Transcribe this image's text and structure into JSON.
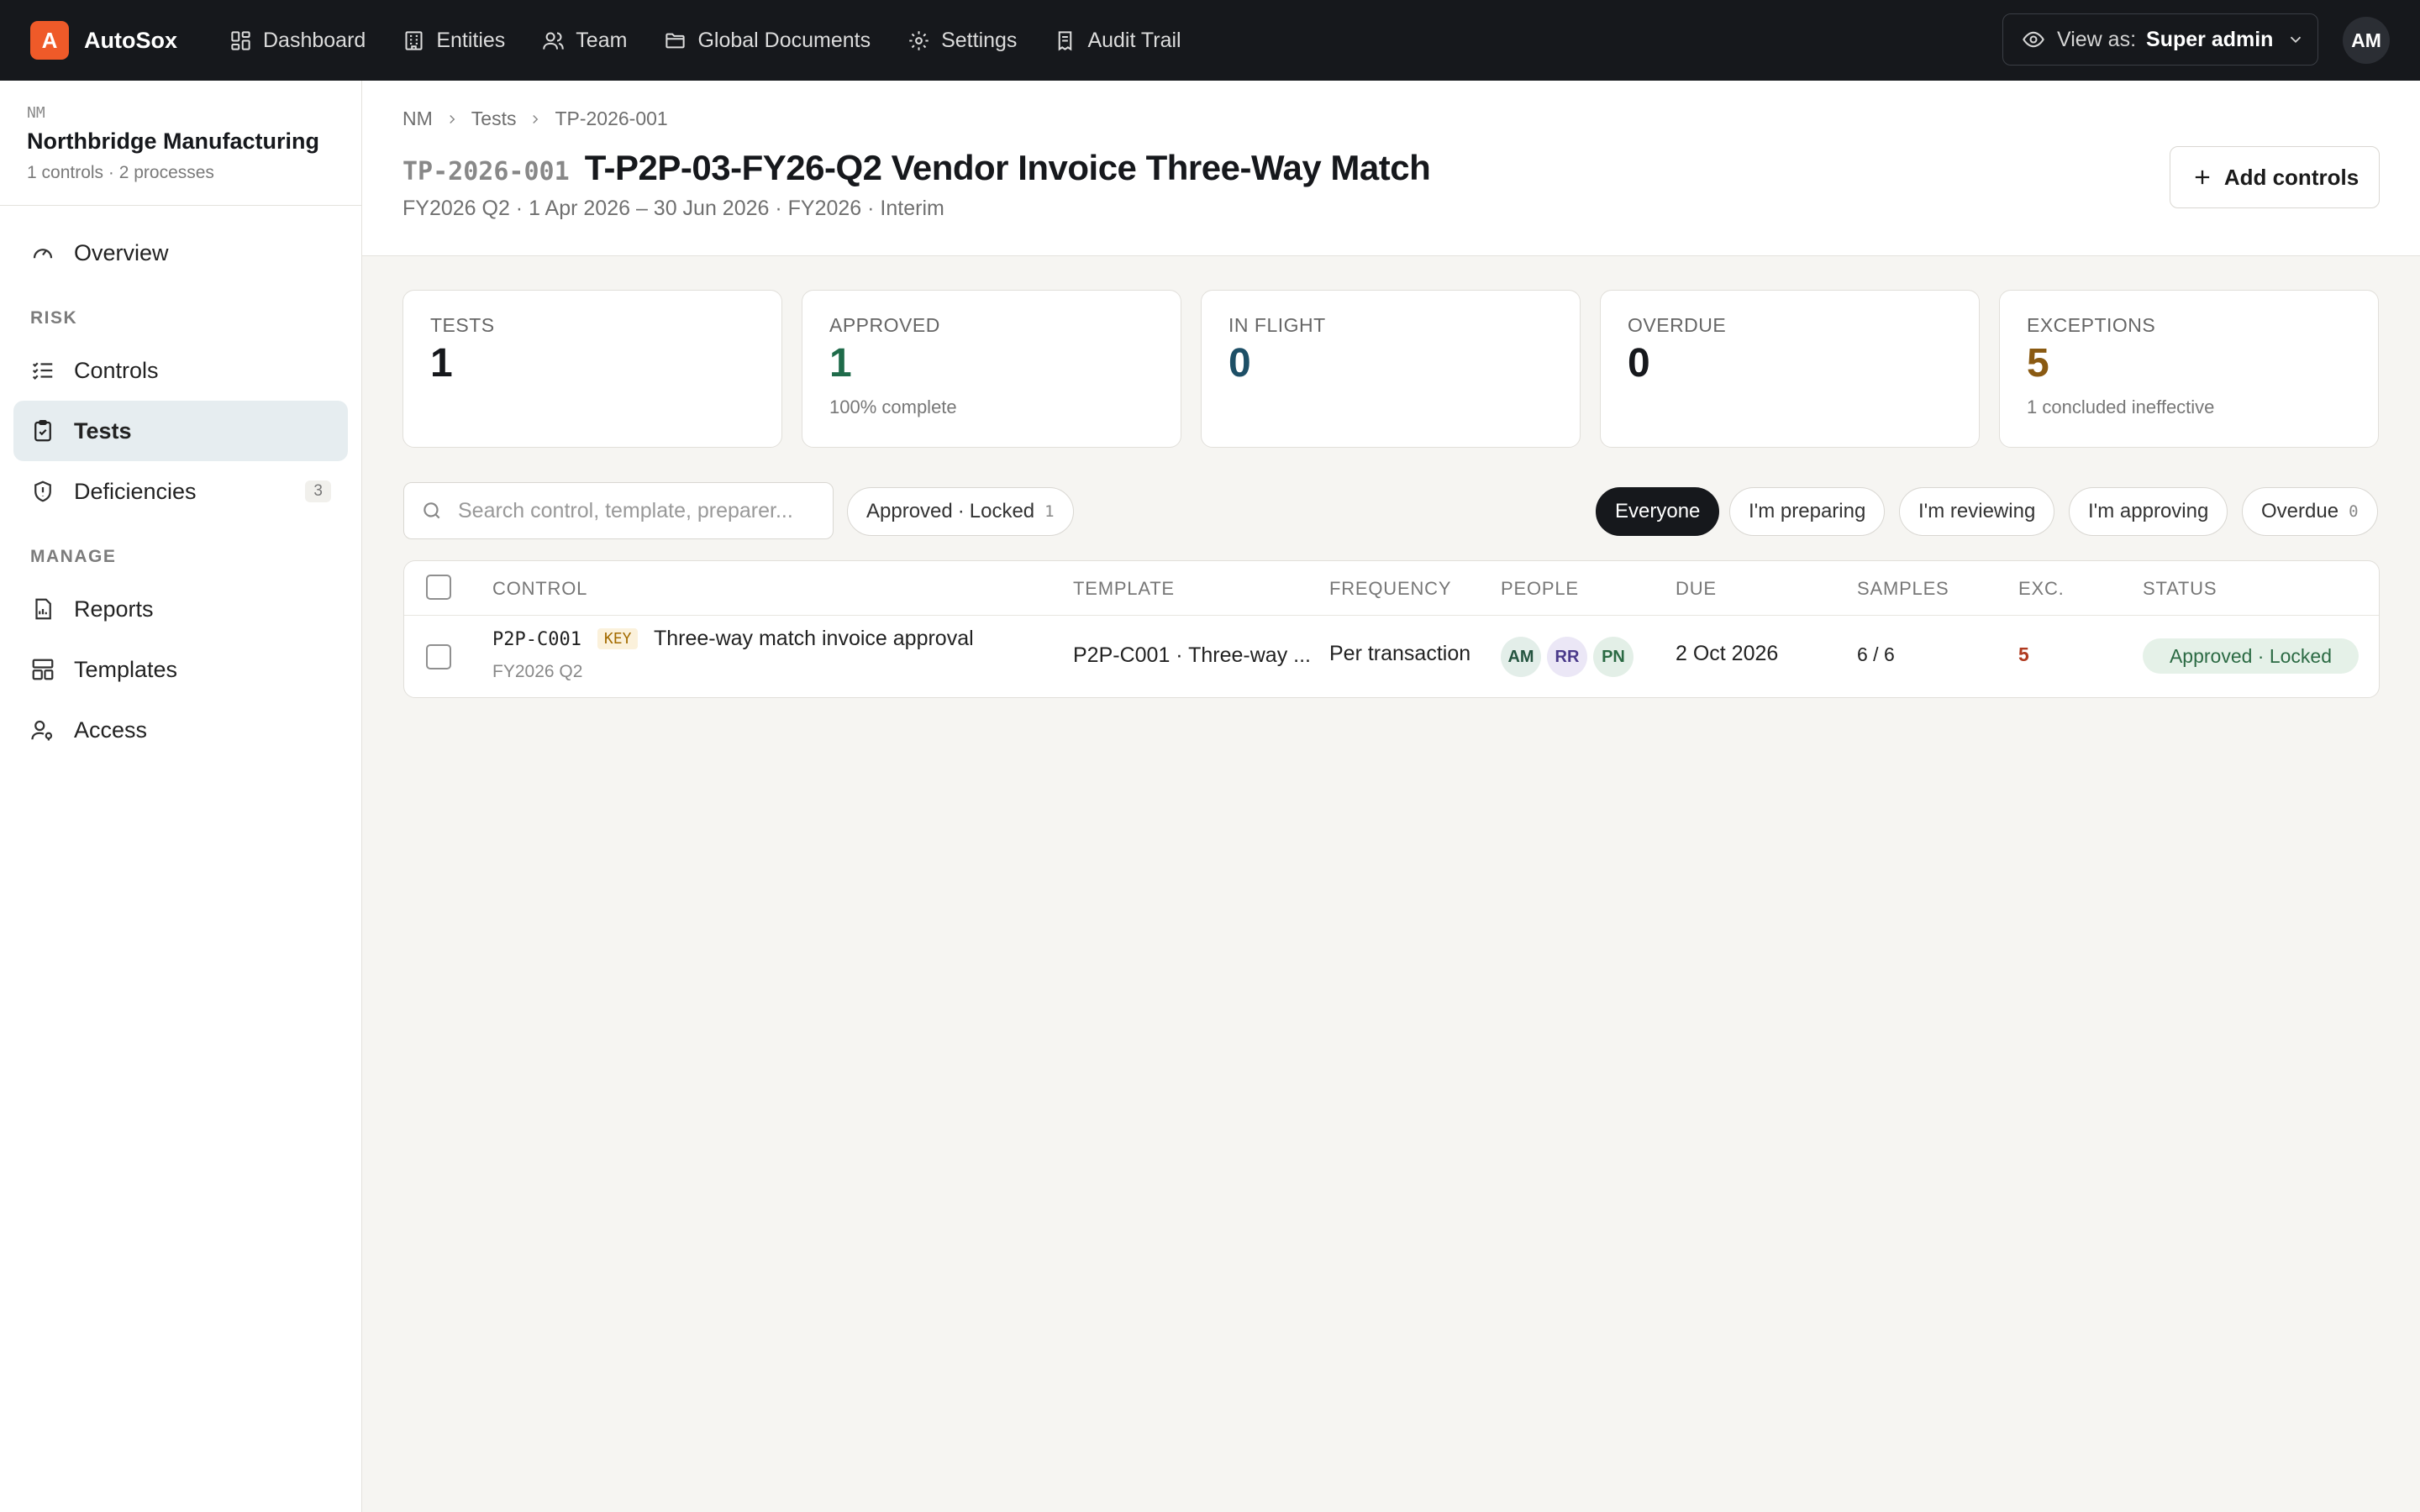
{
  "app": {
    "brand_initial": "A",
    "brand_name": "AutoSox",
    "nav": [
      {
        "label": "Dashboard",
        "icon": "dashboard-icon"
      },
      {
        "label": "Entities",
        "icon": "building-icon"
      },
      {
        "label": "Team",
        "icon": "users-icon"
      },
      {
        "label": "Global Documents",
        "icon": "folder-icon"
      },
      {
        "label": "Settings",
        "icon": "gear-icon"
      },
      {
        "label": "Audit Trail",
        "icon": "receipt-icon"
      }
    ],
    "view_as_label": "View as:",
    "view_as_value": "Super admin",
    "user_initials": "AM"
  },
  "sidebar": {
    "entity_code": "NM",
    "entity_name": "Northbridge Manufacturing",
    "entity_meta": "1 controls · 2 processes",
    "overview": "Overview",
    "risk_label": "RISK",
    "controls": "Controls",
    "tests": "Tests",
    "deficiencies": "Deficiencies",
    "deficiencies_count": "3",
    "manage_label": "MANAGE",
    "reports": "Reports",
    "templates": "Templates",
    "access": "Access"
  },
  "header": {
    "breadcrumb": [
      "NM",
      "Tests",
      "TP-2026-001"
    ],
    "code": "TP-2026-001",
    "title": "T-P2P-03-FY26-Q2 Vendor Invoice Three-Way Match",
    "subtitle": "FY2026 Q2 · 1 Apr 2026 – 30 Jun 2026 · FY2026 · Interim",
    "add_button": "Add controls"
  },
  "stats": [
    {
      "label": "TESTS",
      "value": "1",
      "note": "",
      "color": "#16181c"
    },
    {
      "label": "APPROVED",
      "value": "1",
      "note": "100% complete",
      "color": "#1f6b4a"
    },
    {
      "label": "IN FLIGHT",
      "value": "0",
      "note": "",
      "color": "#1d4f66"
    },
    {
      "label": "OVERDUE",
      "value": "0",
      "note": "",
      "color": "#16181c"
    },
    {
      "label": "EXCEPTIONS",
      "value": "5",
      "note": "1 concluded ineffective",
      "color": "#8a5a12"
    }
  ],
  "filters": {
    "search_placeholder": "Search control, template, preparer...",
    "status_chip": {
      "label_a": "Approved",
      "label_b": "Locked",
      "count": "1"
    },
    "audience": [
      {
        "label": "Everyone",
        "active": true
      },
      {
        "label": "I'm preparing",
        "active": false
      },
      {
        "label": "I'm reviewing",
        "active": false
      },
      {
        "label": "I'm approving",
        "active": false
      },
      {
        "label": "Overdue",
        "active": false,
        "count": "0"
      }
    ]
  },
  "table": {
    "columns": [
      "CONTROL",
      "TEMPLATE",
      "FREQUENCY",
      "PEOPLE",
      "DUE",
      "SAMPLES",
      "EXC.",
      "STATUS"
    ],
    "rows": [
      {
        "control_code": "P2P-C001",
        "key_badge": "KEY",
        "control_name": "Three-way match invoice approval",
        "period": "FY2026 Q2",
        "template": "P2P-C001 · Three-way ...",
        "frequency": "Per transaction",
        "people": [
          {
            "initials": "AM",
            "bg": "#e3eee9",
            "fg": "#24543f"
          },
          {
            "initials": "RR",
            "bg": "#ebe7f6",
            "fg": "#4a3a8a"
          },
          {
            "initials": "PN",
            "bg": "#e3efe7",
            "fg": "#2b6a43"
          }
        ],
        "due": "2 Oct 2026",
        "samples": "6 / 6",
        "exceptions": "5",
        "exceptions_color": "#b03a1f",
        "status": "Approved · Locked"
      }
    ]
  }
}
